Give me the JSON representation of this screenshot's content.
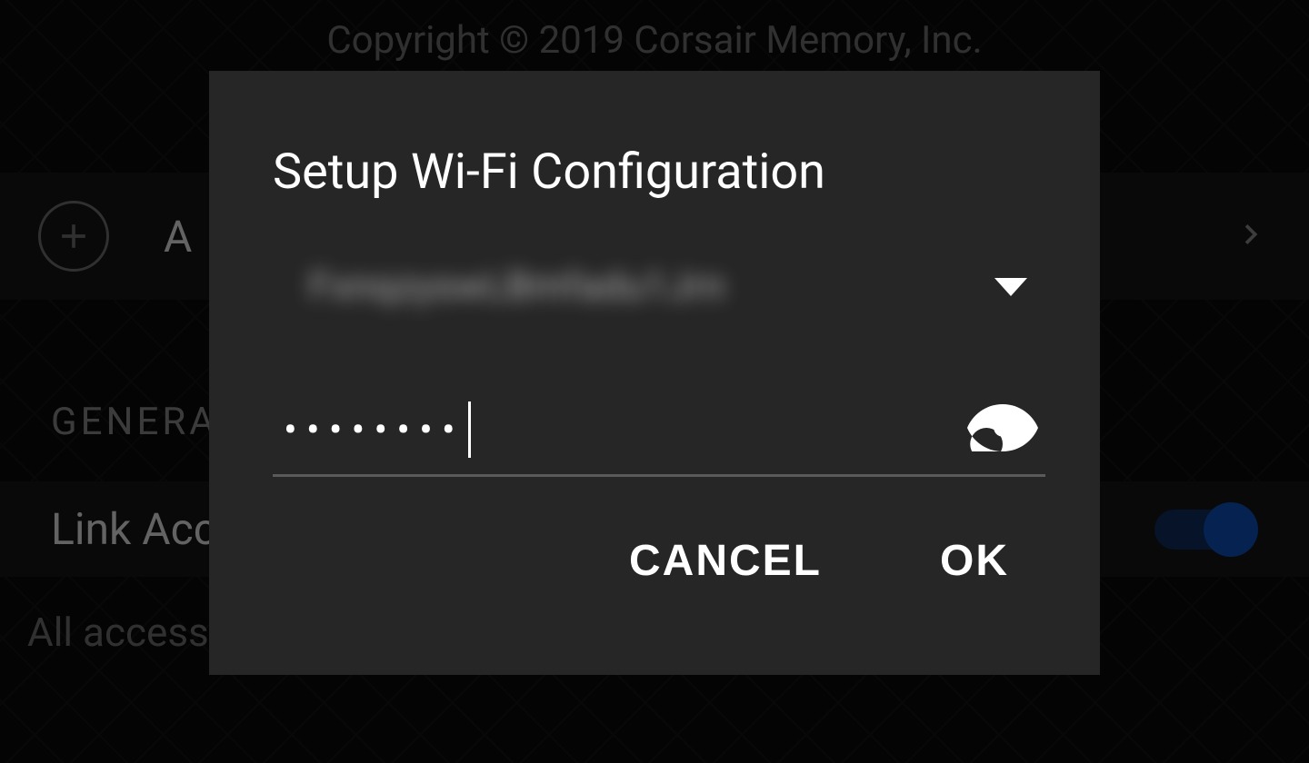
{
  "copyright": "Copyright © 2019 Corsair Memory, Inc.",
  "background": {
    "row_letter": "A",
    "section_label": "GENERAL",
    "link_label": "Link Acc",
    "all_label": "All accesso",
    "toggle_on": true
  },
  "dialog": {
    "title": "Setup Wi-Fi Configuration",
    "ssid_value": "FxnqzyswLBmfadu1Jrn",
    "password_masked": "••••••••",
    "cancel_label": "CANCEL",
    "ok_label": "OK"
  }
}
